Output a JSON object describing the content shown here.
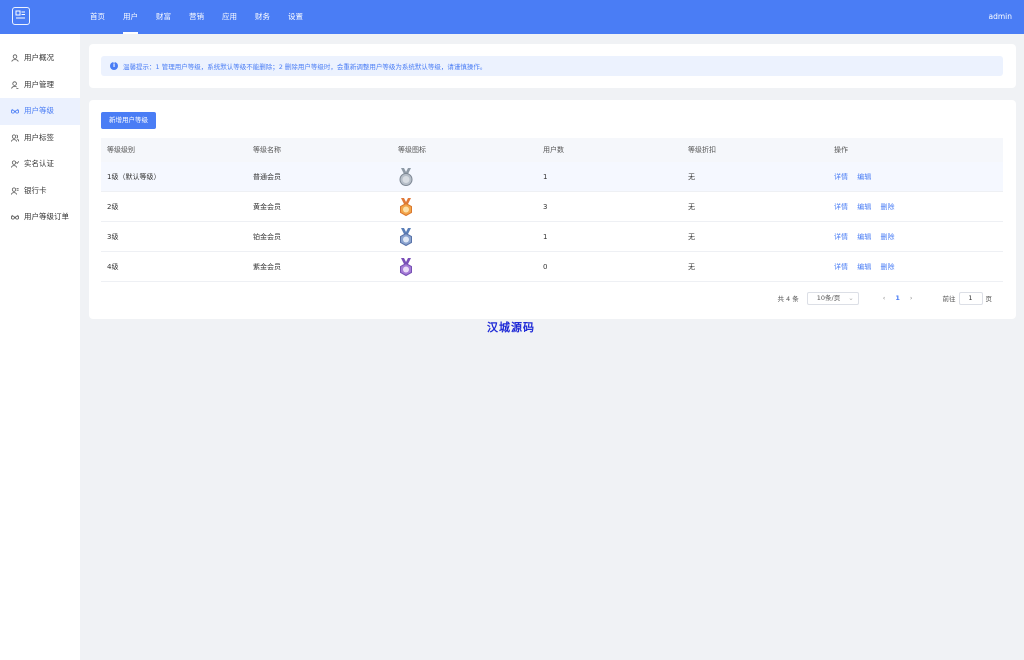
{
  "header": {
    "nav": [
      "首页",
      "用户",
      "财富",
      "营销",
      "应用",
      "财务",
      "设置"
    ],
    "user": "admin"
  },
  "sidebar": {
    "items": [
      "用户概况",
      "用户管理",
      "用户等级",
      "用户标签",
      "实名认证",
      "银行卡",
      "用户等级订单"
    ]
  },
  "tip": {
    "text": "温馨提示：1 管理用户等级，系统默认等级不能删除；2 删除用户等级时，会重新调整用户等级为系统默认等级，请谨慎操作。"
  },
  "table": {
    "add_button": "新增用户等级",
    "columns": [
      "等级级别",
      "等级名称",
      "等级图标",
      "用户数",
      "等级折扣",
      "操作"
    ],
    "rows": [
      {
        "level": "1级（默认等级）",
        "name": "普通会员",
        "icon": "silver-medal-icon",
        "users": "1",
        "discount": "无",
        "actions": [
          "详情",
          "编辑"
        ]
      },
      {
        "level": "2级",
        "name": "黄金会员",
        "icon": "gold-medal-icon",
        "users": "3",
        "discount": "无",
        "actions": [
          "详情",
          "编辑",
          "删除"
        ]
      },
      {
        "level": "3级",
        "name": "铂金会员",
        "icon": "platinum-medal-icon",
        "users": "1",
        "discount": "无",
        "actions": [
          "详情",
          "编辑",
          "删除"
        ]
      },
      {
        "level": "4级",
        "name": "紫金会员",
        "icon": "purple-medal-icon",
        "users": "0",
        "discount": "无",
        "actions": [
          "详情",
          "编辑",
          "删除"
        ]
      }
    ]
  },
  "pagination": {
    "total": "共 4 条",
    "page_size": "10条/页",
    "current": "1",
    "goto_label": "前往",
    "goto_value": "1",
    "page_suffix": "页"
  },
  "watermark": "汉城源码",
  "colors": {
    "primary": "#4a7df5",
    "watermark": "#1f2ad6"
  }
}
